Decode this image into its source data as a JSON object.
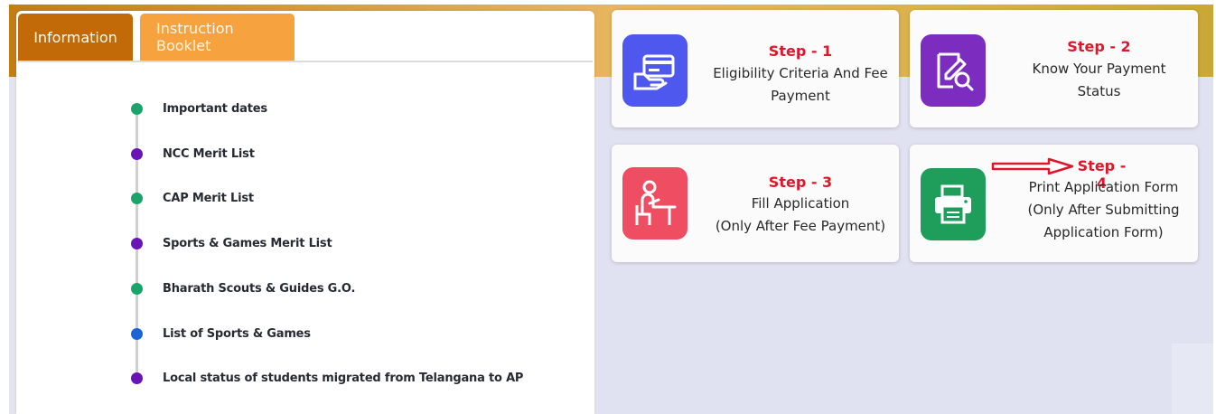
{
  "tabs": {
    "information": "Information",
    "instruction_booklet": "Instruction Booklet"
  },
  "timeline": [
    {
      "label": "Important dates",
      "color": "#1aa36b"
    },
    {
      "label": "NCC Merit List",
      "color": "#6a14b8"
    },
    {
      "label": "CAP Merit List",
      "color": "#1aa36b"
    },
    {
      "label": "Sports & Games Merit List",
      "color": "#6a14b8"
    },
    {
      "label": "Bharath Scouts & Guides G.O.",
      "color": "#1aa36b"
    },
    {
      "label": "List of Sports & Games",
      "color": "#1b63d9"
    },
    {
      "label": "Local status of students migrated from Telangana to AP",
      "color": "#6a14b8"
    }
  ],
  "steps": [
    {
      "title": "Step - 1",
      "lines": [
        "Eligibility Criteria And Fee",
        "Payment"
      ],
      "icon": "payment-card-icon",
      "color": "#4f58ee"
    },
    {
      "title": "Step - 2",
      "lines": [
        "Know Your Payment",
        "Status"
      ],
      "icon": "document-search-icon",
      "color": "#7c2dbf"
    },
    {
      "title": "Step - 3",
      "lines": [
        "Fill Application",
        "(Only After Fee Payment)"
      ],
      "icon": "student-desk-icon",
      "color": "#ef4d62"
    },
    {
      "title": "Step - 4",
      "lines": [
        "Print Application Form",
        "(Only After Submitting",
        "Application Form)"
      ],
      "icon": "printer-icon",
      "color": "#1f9d5b"
    }
  ],
  "colors": {
    "accent_red": "#e0162b",
    "header_orange": "#c26a08"
  }
}
